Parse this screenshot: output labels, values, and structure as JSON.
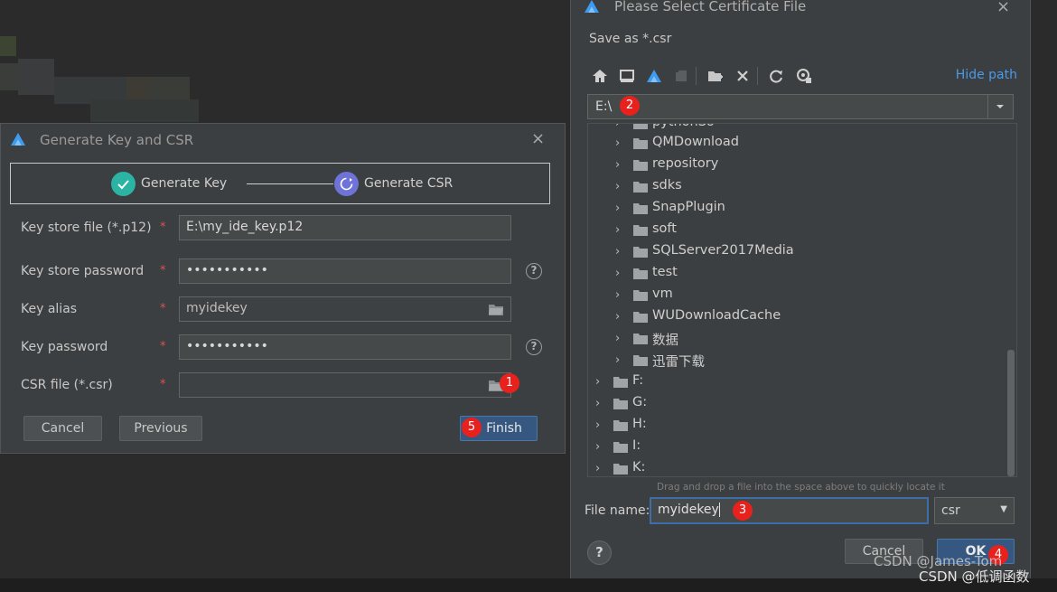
{
  "colors": {
    "accent_blue": "#4b9ae8",
    "primary_button": "#365880",
    "badge_red": "#e8211d",
    "step_done": "#2bb3a3",
    "step_active": "#6e73d8"
  },
  "left_dialog": {
    "title": "Generate Key and CSR",
    "close_icon": "×",
    "steps": [
      {
        "label": "Generate Key",
        "icon": "check-icon"
      },
      {
        "label": "Generate CSR",
        "icon": "refresh-icon"
      }
    ],
    "fields": [
      {
        "label": "Key store file (*.p12)",
        "value": "E:\\my_ide_key.p12"
      },
      {
        "label": "Key store password",
        "value": "•••••••••••"
      },
      {
        "label": "Key alias",
        "value": "myidekey"
      },
      {
        "label": "Key password",
        "value": "•••••••••••"
      },
      {
        "label": "CSR file (*.csr)",
        "value": ""
      }
    ],
    "required_mark": "*",
    "help_glyph": "?",
    "buttons": {
      "cancel": "Cancel",
      "previous": "Previous",
      "finish": "Finish"
    }
  },
  "right_dialog": {
    "title": "Please Select Certificate File",
    "close_icon": "×",
    "subtitle": "Save as *.csr",
    "hide_path": "Hide path",
    "path": "E:\\",
    "tree": [
      {
        "label": "pythonSo",
        "level": 1
      },
      {
        "label": "QMDownload",
        "level": 1
      },
      {
        "label": "repository",
        "level": 1
      },
      {
        "label": "sdks",
        "level": 1
      },
      {
        "label": "SnapPlugin",
        "level": 1
      },
      {
        "label": "soft",
        "level": 1
      },
      {
        "label": "SQLServer2017Media",
        "level": 1
      },
      {
        "label": "test",
        "level": 1
      },
      {
        "label": "vm",
        "level": 1
      },
      {
        "label": "WUDownloadCache",
        "level": 1
      },
      {
        "label": "数据",
        "level": 1
      },
      {
        "label": "迅雷下载",
        "level": 1
      },
      {
        "label": "F:",
        "level": 0
      },
      {
        "label": "G:",
        "level": 0
      },
      {
        "label": "H:",
        "level": 0
      },
      {
        "label": "I:",
        "level": 0
      },
      {
        "label": "K:",
        "level": 0
      }
    ],
    "drop_hint": "Drag and drop a file into the space above to quickly locate it",
    "file_name_label": "File name:",
    "file_name_value": "myidekey",
    "extension": "csr",
    "help_glyph": "?",
    "buttons": {
      "cancel": "Cancel",
      "ok": "OK"
    }
  },
  "badges": [
    "1",
    "2",
    "3",
    "4",
    "5"
  ],
  "watermarks": [
    "CSDN @James-Tom",
    "CSDN @低调函数"
  ]
}
